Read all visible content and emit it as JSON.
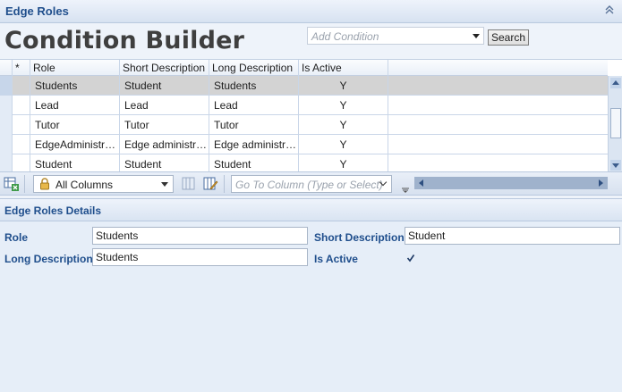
{
  "panel": {
    "title": "Edge Roles",
    "collapse_icon": "double-chevron-up-icon"
  },
  "builder": {
    "heading": "Condition Builder",
    "condition_placeholder": "Add Condition",
    "search_label": "Search"
  },
  "grid": {
    "columns": [
      "*",
      "Role",
      "Short Description",
      "Long Description",
      "Is Active"
    ],
    "rows": [
      {
        "role": "Students",
        "short": "Student",
        "long": "Students",
        "active": "Y",
        "selected": true
      },
      {
        "role": "Lead",
        "short": "Lead",
        "long": "Lead",
        "active": "Y",
        "selected": false
      },
      {
        "role": "Tutor",
        "short": "Tutor",
        "long": "Tutor",
        "active": "Y",
        "selected": false
      },
      {
        "role": "EdgeAdministr…",
        "short": "Edge administr…",
        "long": "Edge administr…",
        "active": "Y",
        "selected": false
      },
      {
        "role": "Student",
        "short": "Student",
        "long": "Student",
        "active": "Y",
        "selected": false
      }
    ]
  },
  "toolbar": {
    "column_selector": "All Columns",
    "goto_placeholder": "Go To Column (Type or Select)"
  },
  "details": {
    "title": "Edge Roles Details",
    "role_label": "Role",
    "role_value": "Students",
    "short_label": "Short Description",
    "short_value": "Student",
    "long_label": "Long Description",
    "long_value": "Students",
    "active_label": "Is Active",
    "active_checked": true
  },
  "colors": {
    "accent": "#1f4e8c",
    "selected_row": "#d3d3d3"
  }
}
